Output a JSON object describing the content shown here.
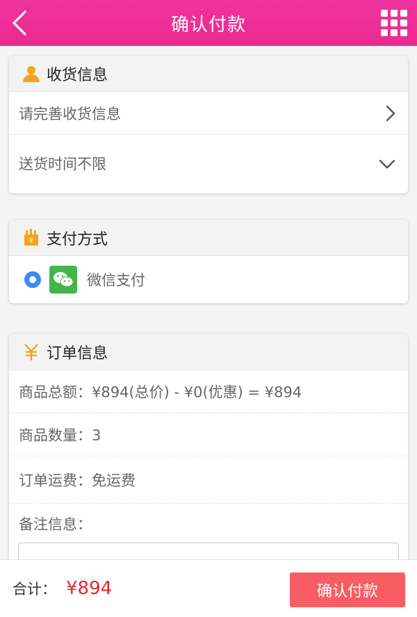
{
  "header": {
    "title": "确认付款",
    "back_icon": "chevron-left-icon",
    "menu_icon": "grid-menu-icon",
    "color": "#ee2f97"
  },
  "shipping": {
    "title": "收货信息",
    "icon": "user-icon",
    "address_prompt": "请完善收货信息",
    "delivery_time": "送货时间不限"
  },
  "payment": {
    "title": "支付方式",
    "icon": "wallet-icon",
    "method": "微信支付",
    "method_icon": "wechat-icon"
  },
  "order": {
    "title": "订单信息",
    "icon": "yen-icon",
    "amount": "商品总额：¥894(总价) - ¥0(优惠) = ¥894",
    "quantity": "商品数量：3",
    "shipping_fee": "订单运费：免运费",
    "remark_label": "备注信息："
  },
  "footer": {
    "total_label": "合计：",
    "total_value": "¥894",
    "confirm_label": "确认付款",
    "accent": "#f75d62"
  }
}
